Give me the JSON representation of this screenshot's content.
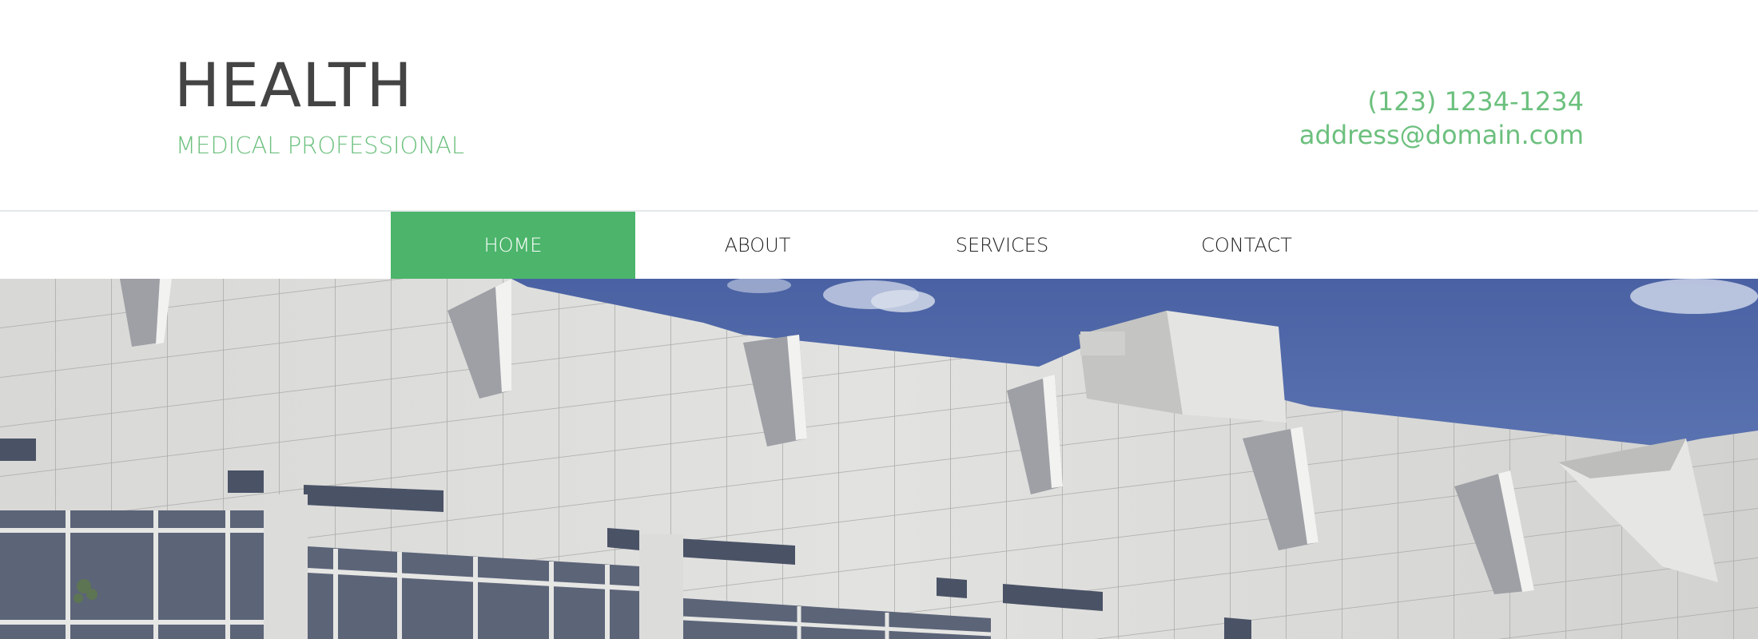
{
  "brand": {
    "title": "HEALTH",
    "subtitle": "MEDICAL PROFESSIONAL"
  },
  "contact": {
    "phone": "(123) 1234-1234",
    "email": "address@domain.com"
  },
  "nav": {
    "items": [
      {
        "label": "HOME",
        "active": true
      },
      {
        "label": "ABOUT",
        "active": false
      },
      {
        "label": "SERVICES",
        "active": false
      },
      {
        "label": "CONTACT",
        "active": false
      }
    ]
  },
  "hero": {
    "image_subject": "white tiled modern building facade against blue sky"
  },
  "colors": {
    "accent": "#4cb56b",
    "accent_text": "#6cc07e",
    "title_text": "#444444",
    "sky": "#4f69a8"
  }
}
